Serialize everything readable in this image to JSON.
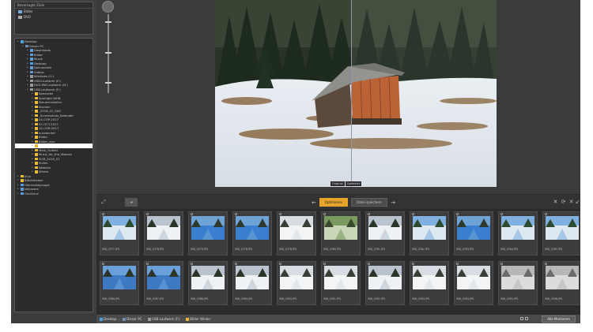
{
  "sidebar": {
    "recent_title": "Bevorzugte Ziele",
    "recent_items": [
      {
        "label": "Bilder",
        "icon": "pictures-icon"
      },
      {
        "label": "DVD",
        "icon": "dvd-drive-icon"
      }
    ],
    "tree": [
      {
        "label": "Desktop",
        "level": 0,
        "icon": "desk"
      },
      {
        "label": "Dieser PC",
        "level": 1,
        "icon": "pc"
      },
      {
        "label": "Downloads",
        "level": 2,
        "icon": "blue"
      },
      {
        "label": "Bilder",
        "level": 2,
        "icon": "blue"
      },
      {
        "label": "Musik",
        "level": 2,
        "icon": "blue"
      },
      {
        "label": "Desktop",
        "level": 2,
        "icon": "desk"
      },
      {
        "label": "Dokumente",
        "level": 2,
        "icon": "blue"
      },
      {
        "label": "Videos",
        "level": 2,
        "icon": "blue"
      },
      {
        "label": "Windows (C:)",
        "level": 2,
        "icon": "drive"
      },
      {
        "label": "USB-Laufwerk (E:)",
        "level": 2,
        "icon": "drive"
      },
      {
        "label": "DVD-RW-Laufwerk (D:)",
        "level": 2,
        "icon": "drive"
      },
      {
        "label": "USB-Laufwerk (F:)",
        "level": 2,
        "icon": "drive"
      },
      {
        "label": "Spezialist",
        "level": 3,
        "icon": "fold"
      },
      {
        "label": "Spotlight WHB",
        "level": 3,
        "icon": "fold"
      },
      {
        "label": "Steuererstellen",
        "level": 3,
        "icon": "fold"
      },
      {
        "label": "Studien",
        "level": 3,
        "icon": "fold"
      },
      {
        "label": "_2018_01_SAG",
        "level": 3,
        "icon": "fold"
      },
      {
        "label": "_Screenshots_Kalender",
        "level": 3,
        "icon": "fold"
      },
      {
        "label": "04-COP-2017",
        "level": 3,
        "icon": "fold"
      },
      {
        "label": "07-OCT-2017",
        "level": 3,
        "icon": "fold"
      },
      {
        "label": "15-COR-2017",
        "level": 3,
        "icon": "fold"
      },
      {
        "label": "ausstechet",
        "level": 3,
        "icon": "fold"
      },
      {
        "label": "Bilder",
        "level": 3,
        "icon": "fold"
      },
      {
        "label": "Bilder_neu",
        "level": 3,
        "icon": "fold"
      },
      {
        "label": "",
        "level": 3,
        "icon": "fold",
        "selected": true
      },
      {
        "label": "Mein_Ordner",
        "level": 3,
        "icon": "fold"
      },
      {
        "label": "Music_for_the_Masses",
        "level": 3,
        "icon": "fold"
      },
      {
        "label": "SCM_2016_07",
        "level": 3,
        "icon": "fold"
      },
      {
        "label": "Sollen",
        "level": 3,
        "icon": "fold"
      },
      {
        "label": "Website",
        "level": 3,
        "icon": "fold"
      },
      {
        "label": "Winter",
        "level": 3,
        "icon": "fold"
      },
      {
        "label": "Jinja",
        "level": 0,
        "icon": "fold"
      },
      {
        "label": "Bibliotheken",
        "level": 0,
        "icon": "fold"
      },
      {
        "label": "Heimnetzgruppe",
        "level": 0,
        "icon": "blue"
      },
      {
        "label": "Netzwerk",
        "level": 0,
        "icon": "blue"
      },
      {
        "label": "OneDrive",
        "level": 0,
        "icon": "blue"
      }
    ]
  },
  "preview": {
    "labels": {
      "original": "Original",
      "optimized": "Optimiert"
    }
  },
  "toolbar": {
    "prev_label": "←",
    "optimize_label": "Optimieren",
    "save_label": "Datei speichern",
    "next_label": "→",
    "expand_label": "⤢",
    "collapse_label": "◂",
    "right_tools": [
      "✕",
      "⟳",
      "✕",
      "↙"
    ]
  },
  "thumbnails": [
    {
      "name": "IMG_0377.JPG",
      "scene": "blue-snow"
    },
    {
      "name": "IMG_0378.JPG",
      "scene": "snow-trees"
    },
    {
      "name": "IMG_0379.JPG",
      "scene": "blue-road"
    },
    {
      "name": "IMG_0376.JPG",
      "scene": "blue-road"
    },
    {
      "name": "IMG_0378.JPG",
      "scene": "snow-sun"
    },
    {
      "name": "IMG_0380.JPG",
      "scene": "green"
    },
    {
      "name": "IMG_0381.JPG",
      "scene": "snow-trees"
    },
    {
      "name": "IMG_0382.JPG",
      "scene": "blue-snow"
    },
    {
      "name": "IMG_0383.JPG",
      "scene": "blue-road"
    },
    {
      "name": "IMG_0384.JPG",
      "scene": "blue-snow"
    },
    {
      "name": "IMG_0385.JPG",
      "scene": "blue-snow"
    },
    {
      "name": "IMG_0386.JPG",
      "scene": "sky-lake"
    },
    {
      "name": "IMG_0387.JPG",
      "scene": "sky-lake"
    },
    {
      "name": "IMG_0388.JPG",
      "scene": "snow-trees"
    },
    {
      "name": "IMG_0389.JPG",
      "scene": "snow-trees"
    },
    {
      "name": "IMG_0390.JPG",
      "scene": "snow-sun"
    },
    {
      "name": "IMG_0391.JPG",
      "scene": "snow-sun"
    },
    {
      "name": "IMG_0392.JPG",
      "scene": "snow-trees"
    },
    {
      "name": "IMG_0393.JPG",
      "scene": "snow-sun"
    },
    {
      "name": "IMG_0394.JPG",
      "scene": "snow-sun"
    },
    {
      "name": "IMG_0395.JPG",
      "scene": "gray"
    },
    {
      "name": "IMG_0396.JPG",
      "scene": "gray"
    }
  ],
  "statusbar": {
    "crumbs": [
      {
        "label": "Desktop",
        "icon": "desk"
      },
      {
        "label": "Dieser PC",
        "icon": "pc"
      },
      {
        "label": "USB-Laufwerk (F:)",
        "icon": "drive"
      },
      {
        "label": "Bilder Winter",
        "icon": "fold"
      }
    ],
    "action_label": "Alle Markieren"
  },
  "colors": {
    "accent": "#e6a52a",
    "panel": "#3b3b3d",
    "dark_panel": "#2b2b2d"
  }
}
